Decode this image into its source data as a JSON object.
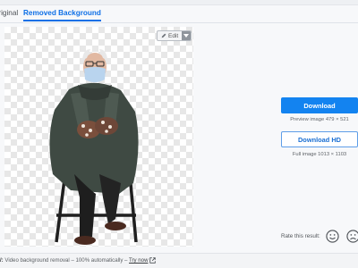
{
  "tabs": {
    "original_label": "Original",
    "removed_label": "Removed Background"
  },
  "preview": {
    "edit_label": "Edit",
    "edit_icon": "pencil-icon",
    "caret_icon": "caret-down-icon",
    "checker_color": "#e7e7e7"
  },
  "download": {
    "label": "Download",
    "preview_info": "Preview image 479 × 521"
  },
  "download_hd": {
    "label": "Download HD",
    "full_info": "Full image 1013 × 1103"
  },
  "rating": {
    "label": "Rate this result:",
    "happy_icon": "smiley-face-icon",
    "sad_icon": "sad-face-icon"
  },
  "footer": {
    "prefix": "W:",
    "text": " Video background removal – 100% automatically – ",
    "link": "Try now",
    "link_icon": "external-link-icon"
  },
  "colors": {
    "accent": "#1383f0",
    "tab_active": "#0f70e6"
  }
}
